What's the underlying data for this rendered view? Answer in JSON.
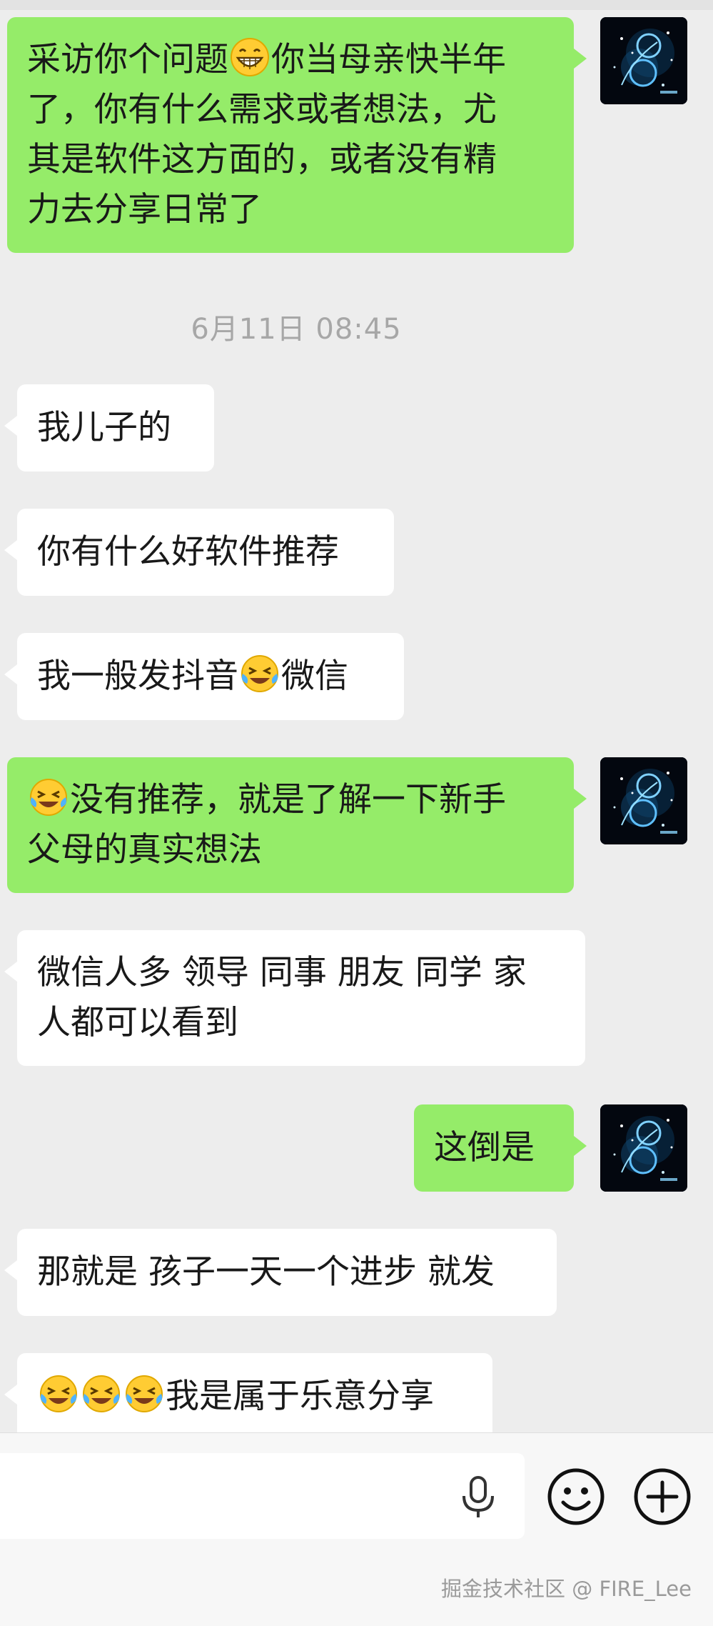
{
  "chat": {
    "timestamp": "6月11日 08:45",
    "messages": [
      {
        "lines": [
          "采访你个问题",
          "你当母亲快半年",
          "了，你有什么需求或者想法，尤",
          "其是软件这方面的，或者没有精",
          "力去分享日常了"
        ]
      },
      {
        "text": "我儿子的"
      },
      {
        "text": "你有什么好软件推荐"
      },
      {
        "parts": [
          "我一般发抖音",
          "微信"
        ]
      },
      {
        "lines": [
          "没有推荐，就是了解一下新手",
          "父母的真实想法"
        ]
      },
      {
        "lines": [
          "微信人多 领导 同事 朋友 同学 家",
          "人都可以看到"
        ]
      },
      {
        "text": "这倒是"
      },
      {
        "text": "那就是 孩子一天一个进步 就发"
      },
      {
        "text": "我是属于乐意分享"
      }
    ]
  },
  "input_bar": {
    "mic_icon": "microphone-icon",
    "emoji_icon": "smiley-icon",
    "plus_icon": "plus-circle-icon"
  },
  "watermark": "掘金技术社区 @ FIRE_Lee",
  "colors": {
    "outgoing_bubble": "#95ec69",
    "incoming_bubble": "#ffffff",
    "background": "#ededed"
  }
}
